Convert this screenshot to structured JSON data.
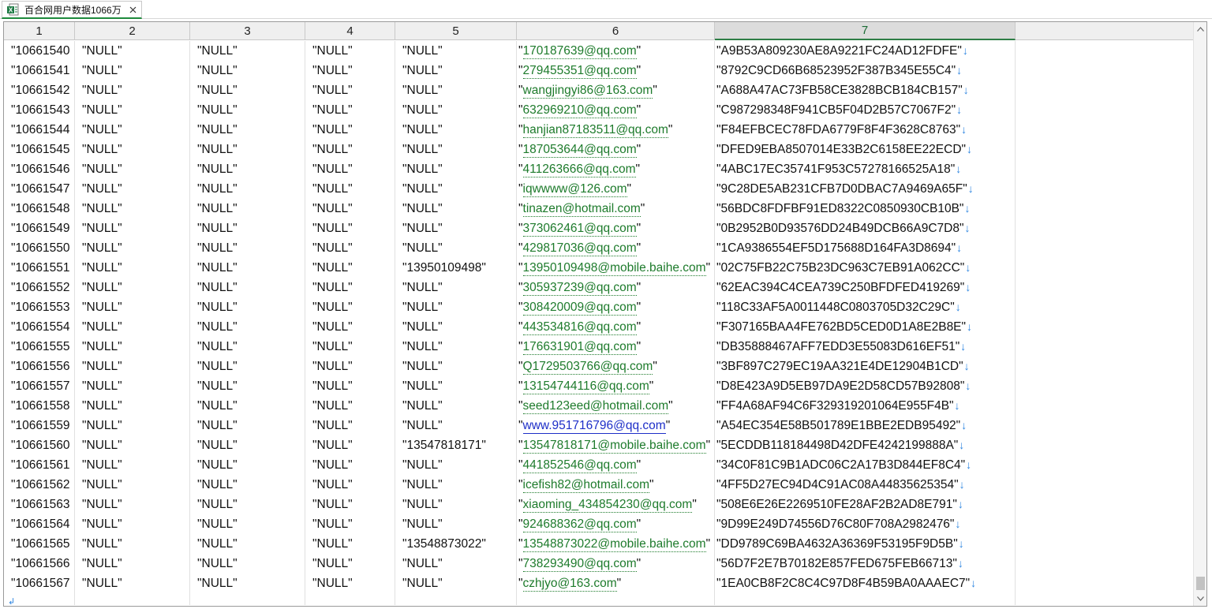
{
  "tab": {
    "title": "百合网用户数据1066万",
    "icon": "excel-file-icon",
    "close_icon": "close-icon"
  },
  "columns": [
    {
      "label": "1"
    },
    {
      "label": "2"
    },
    {
      "label": "3"
    },
    {
      "label": "4"
    },
    {
      "label": "5"
    },
    {
      "label": "6"
    },
    {
      "label": "7"
    }
  ],
  "active_column": "7",
  "rows": [
    [
      "\"10661540",
      "\"NULL\"",
      "\"NULL\"",
      "\"NULL\"",
      "\"NULL\"",
      "170187639@qq.com",
      "\"A9B53A809230AE8A9221FC24AD12FDFE\""
    ],
    [
      "\"10661541",
      "\"NULL\"",
      "\"NULL\"",
      "\"NULL\"",
      "\"NULL\"",
      "279455351@qq.com",
      "\"8792C9CD66B68523952F387B345E55C4\""
    ],
    [
      "\"10661542",
      "\"NULL\"",
      "\"NULL\"",
      "\"NULL\"",
      "\"NULL\"",
      "wangjingyi86@163.com",
      "\"A688A47AC73FB58CE3828BCB184CB157\""
    ],
    [
      "\"10661543",
      "\"NULL\"",
      "\"NULL\"",
      "\"NULL\"",
      "\"NULL\"",
      "632969210@qq.com",
      "\"C987298348F941CB5F04D2B57C7067F2\""
    ],
    [
      "\"10661544",
      "\"NULL\"",
      "\"NULL\"",
      "\"NULL\"",
      "\"NULL\"",
      "hanjian87183511@qq.com",
      "\"F84EFBCEC78FDA6779F8F4F3628C8763\""
    ],
    [
      "\"10661545",
      "\"NULL\"",
      "\"NULL\"",
      "\"NULL\"",
      "\"NULL\"",
      "187053644@qq.com",
      "\"DFED9EBA8507014E33B2C6158EE22ECD\""
    ],
    [
      "\"10661546",
      "\"NULL\"",
      "\"NULL\"",
      "\"NULL\"",
      "\"NULL\"",
      "411263666@qq.com",
      "\"4ABC17EC35741F953C57278166525A18\""
    ],
    [
      "\"10661547",
      "\"NULL\"",
      "\"NULL\"",
      "\"NULL\"",
      "\"NULL\"",
      "iqwwww@126.com",
      "\"9C28DE5AB231CFB7D0DBAC7A9469A65F\""
    ],
    [
      "\"10661548",
      "\"NULL\"",
      "\"NULL\"",
      "\"NULL\"",
      "\"NULL\"",
      "tinazen@hotmail.com",
      "\"56BDC8FDFBF91ED8322C0850930CB10B\""
    ],
    [
      "\"10661549",
      "\"NULL\"",
      "\"NULL\"",
      "\"NULL\"",
      "\"NULL\"",
      "373062461@qq.com",
      "\"0B2952B0D93576DD24B49DCB66A9C7D8\""
    ],
    [
      "\"10661550",
      "\"NULL\"",
      "\"NULL\"",
      "\"NULL\"",
      "\"NULL\"",
      "429817036@qq.com",
      "\"1CA9386554EF5D175688D164FA3D8694\""
    ],
    [
      "\"10661551",
      "\"NULL\"",
      "\"NULL\"",
      "\"NULL\"",
      "\"13950109498\"",
      "13950109498@mobile.baihe.com",
      "\"02C75FB22C75B23DC963C7EB91A062CC\""
    ],
    [
      "\"10661552",
      "\"NULL\"",
      "\"NULL\"",
      "\"NULL\"",
      "\"NULL\"",
      "305937239@qq.com",
      "\"62EAC394C4CEA739C250BFDFED419269\""
    ],
    [
      "\"10661553",
      "\"NULL\"",
      "\"NULL\"",
      "\"NULL\"",
      "\"NULL\"",
      "308420009@qq.com",
      "\"118C33AF5A0011448C0803705D32C29C\""
    ],
    [
      "\"10661554",
      "\"NULL\"",
      "\"NULL\"",
      "\"NULL\"",
      "\"NULL\"",
      "443534816@qq.com",
      "\"F307165BAA4FE762BD5CED0D1A8E2B8E\""
    ],
    [
      "\"10661555",
      "\"NULL\"",
      "\"NULL\"",
      "\"NULL\"",
      "\"NULL\"",
      "176631901@qq.com",
      "\"DB35888467AFF7EDD3E55083D616EF51\""
    ],
    [
      "\"10661556",
      "\"NULL\"",
      "\"NULL\"",
      "\"NULL\"",
      "\"NULL\"",
      "Q1729503766@qq.com",
      "\"3BF897C279EC19AA321E4DE12904B1CD\""
    ],
    [
      "\"10661557",
      "\"NULL\"",
      "\"NULL\"",
      "\"NULL\"",
      "\"NULL\"",
      "13154744116@qq.com",
      "\"D8E423A9D5EB97DA9E2D58CD57B92808\""
    ],
    [
      "\"10661558",
      "\"NULL\"",
      "\"NULL\"",
      "\"NULL\"",
      "\"NULL\"",
      "seed123eed@hotmail.com",
      "\"FF4A68AF94C6F329319201064E955F4B\""
    ],
    [
      "\"10661559",
      "\"NULL\"",
      "\"NULL\"",
      "\"NULL\"",
      "\"NULL\"",
      "www.951716796@qq.com",
      "\"A54EC354E58B501789E1BBE2EDB95492\""
    ],
    [
      "\"10661560",
      "\"NULL\"",
      "\"NULL\"",
      "\"NULL\"",
      "\"13547818171\"",
      "13547818171@mobile.baihe.com",
      "\"5ECDDB118184498D42DFE4242199888A\""
    ],
    [
      "\"10661561",
      "\"NULL\"",
      "\"NULL\"",
      "\"NULL\"",
      "\"NULL\"",
      "441852546@qq.com",
      "\"34C0F81C9B1ADC06C2A17B3D844EF8C4\""
    ],
    [
      "\"10661562",
      "\"NULL\"",
      "\"NULL\"",
      "\"NULL\"",
      "\"NULL\"",
      "icefish82@hotmail.com",
      "\"4FF5D27EC94D4C91AC08A44835625354\""
    ],
    [
      "\"10661563",
      "\"NULL\"",
      "\"NULL\"",
      "\"NULL\"",
      "\"NULL\"",
      "xiaoming_434854230@qq.com",
      "\"508E6E26E2269510FE28AF2B2AD8E791\""
    ],
    [
      "\"10661564",
      "\"NULL\"",
      "\"NULL\"",
      "\"NULL\"",
      "\"NULL\"",
      "924688362@qq.com",
      "\"9D99E249D74556D76C80F708A2982476\""
    ],
    [
      "\"10661565",
      "\"NULL\"",
      "\"NULL\"",
      "\"NULL\"",
      "\"13548873022\"",
      "13548873022@mobile.baihe.com",
      "\"DD9789C69BA4632A36369F53195F9D5B\""
    ],
    [
      "\"10661566",
      "\"NULL\"",
      "\"NULL\"",
      "\"NULL\"",
      "\"NULL\"",
      "738293490@qq.com",
      "\"56D7F2E7B70182E857FED675FEB66713\""
    ],
    [
      "\"10661567",
      "\"NULL\"",
      "\"NULL\"",
      "\"NULL\"",
      "\"NULL\"",
      "czhjyo@163.com",
      "\"1EA0CB8F2C8C4C97D8F4B59BA0AAAEC7\""
    ]
  ],
  "row_end_marker": "↓",
  "colors": {
    "link_green": "#1e7b2c",
    "link_blue": "#1e2fc8",
    "active_header_text": "#1a6b34",
    "return_marker": "#2f86e0"
  }
}
